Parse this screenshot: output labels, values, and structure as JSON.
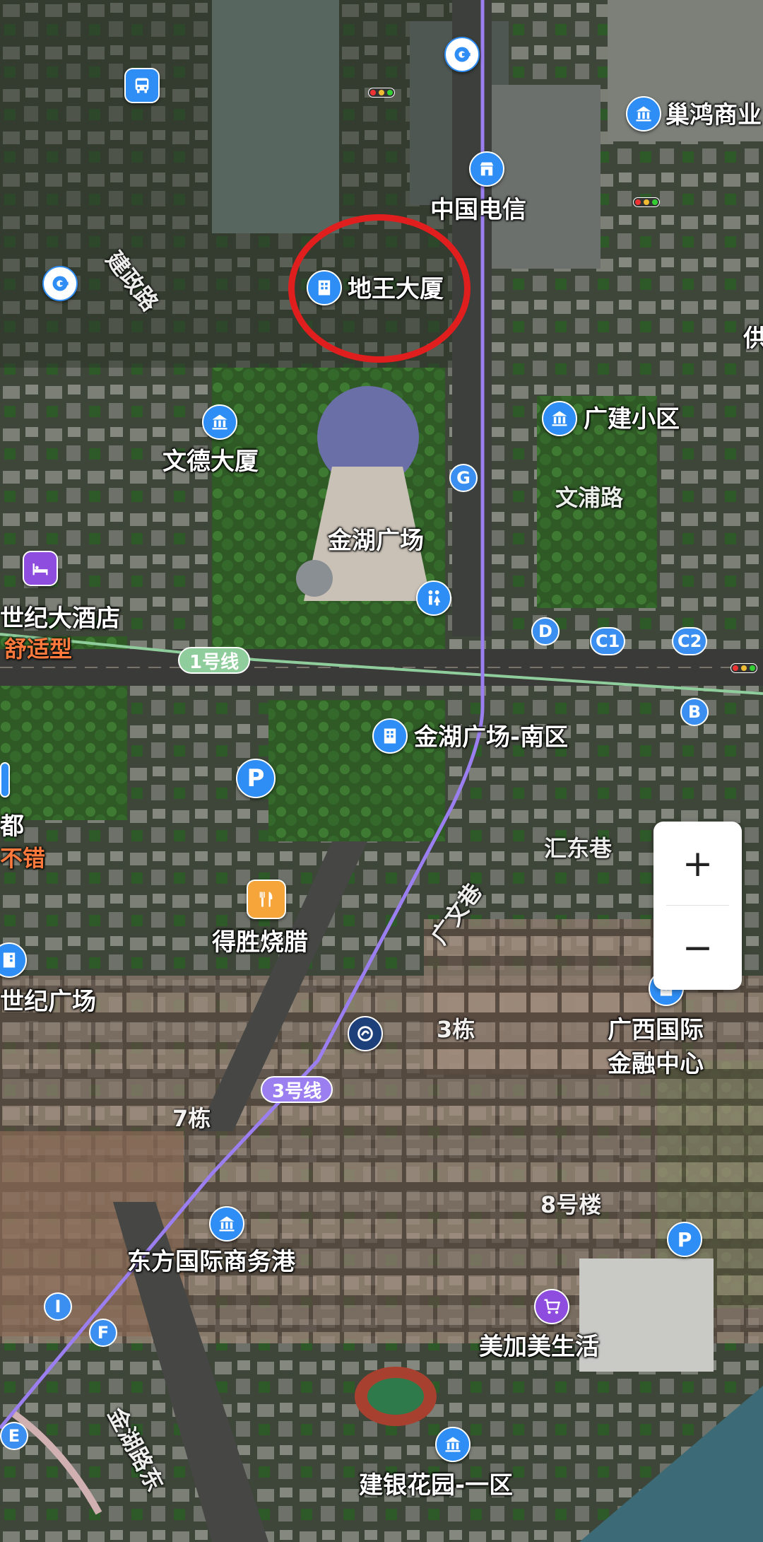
{
  "map": {
    "view": "satellite",
    "highlight_color": "#e11e1e",
    "colors": {
      "metro_line_3": "#9b7ef0",
      "metro_line_1": "#8fce9c",
      "poi_blue": "#2f8ef5",
      "poi_purple": "#8e4dde",
      "poi_orange": "#f6a53a",
      "secondary_label": "#ff7a3c"
    }
  },
  "pois": {
    "chaohong": "巢鸿商业",
    "china_telecom": "中国电信",
    "diwang": "地王大厦",
    "wende": "文德大厦",
    "guangjian": "广建小区",
    "jinhu_square": "金湖广场",
    "century_hotel": "世纪大酒店",
    "century_hotel_sub": "舒适型",
    "jinhu_south": "金湖广场-南区",
    "du": "都",
    "du_sub": "不错",
    "desheng": "得胜烧腊",
    "century_plaza": "世纪广场",
    "gxifc_line1": "广西国际",
    "gxifc_line2": "金融中心",
    "building_3": "3栋",
    "building_7": "7栋",
    "building_8": "8号楼",
    "dongfang": "东方国际商务港",
    "meijiamei": "美加美生活",
    "jianyin": "建银花园-一区",
    "edge_right": "供"
  },
  "roads": {
    "jianzheng": "建政路",
    "wenpu": "文浦路",
    "huidong": "汇东巷",
    "guangwen": "广文巷",
    "jinhu_east": "金湖路东"
  },
  "metro": {
    "line1": "1号线",
    "line3": "3号线"
  },
  "exits": {
    "G": "G",
    "D": "D",
    "C1": "C1",
    "C2": "C2",
    "B": "B",
    "I": "I",
    "F": "F",
    "E": "E"
  },
  "icons": {
    "parking": "P",
    "zoom_in": "+",
    "zoom_out": "−"
  }
}
